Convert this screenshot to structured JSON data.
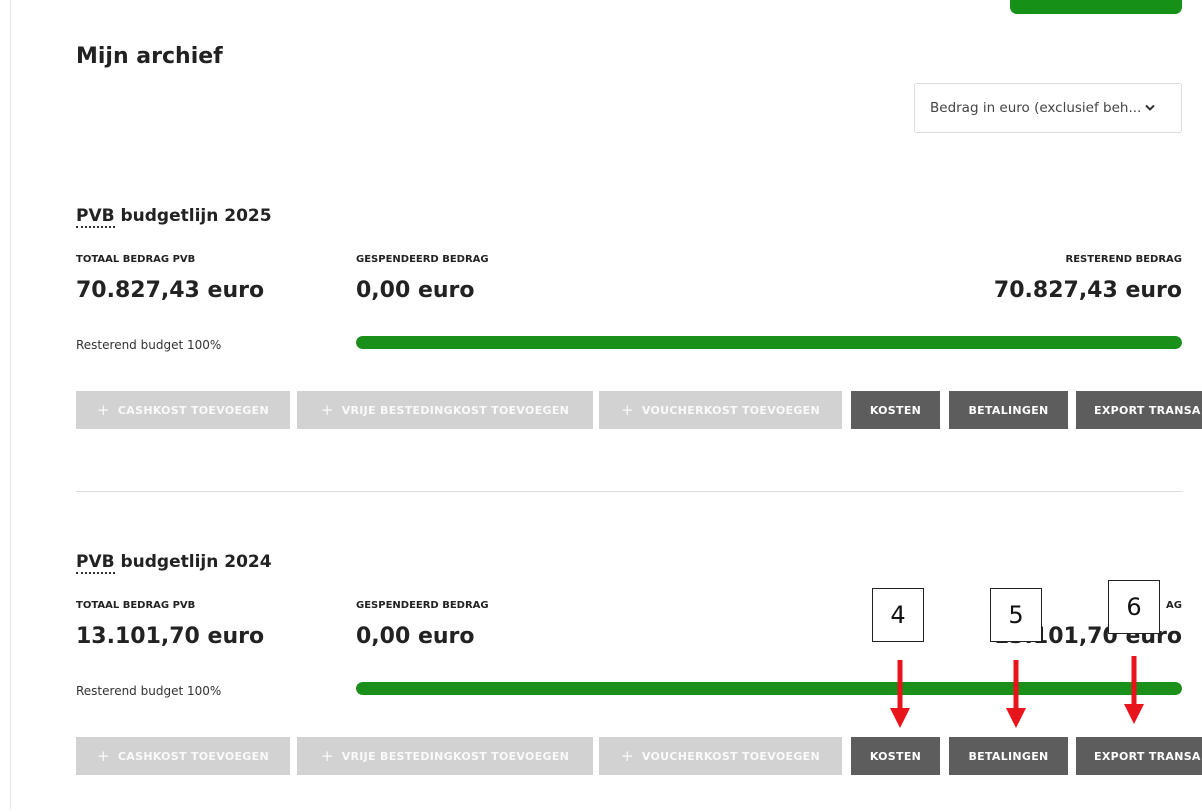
{
  "page": {
    "title": "Mijn archief"
  },
  "currency_select": {
    "value": "Bedrag in euro (exclusief beh..."
  },
  "budgets": [
    {
      "title_abbr": "PVB",
      "title_rest": " budgetlijn 2025",
      "labels": {
        "total": "TOTAAL BEDRAG PVB",
        "spent": "GESPENDEERD BEDRAG",
        "remaining": "RESTEREND BEDRAG"
      },
      "total": "70.827,43 euro",
      "spent": "0,00 euro",
      "remaining": "70.827,43 euro",
      "remaining_text": "Resterend budget 100%",
      "remaining_fraction": 1.0,
      "buttons": {
        "cash": "CASHKOST TOEVOEGEN",
        "free": "VRIJE BESTEDINGKOST TOEVOEGEN",
        "voucher": "VOUCHERKOST TOEVOEGEN",
        "costs": "KOSTEN",
        "payments": "BETALINGEN",
        "export": "EXPORT TRANSA"
      }
    },
    {
      "title_abbr": "PVB",
      "title_rest": " budgetlijn 2024",
      "labels": {
        "total": "TOTAAL BEDRAG PVB",
        "spent": "GESPENDEERD BEDRAG",
        "remaining": "RESTER    AG"
      },
      "total": "13.101,70 euro",
      "spent": "0,00 euro",
      "remaining": "13.101,70 euro",
      "remaining_text": "Resterend budget 100%",
      "remaining_fraction": 1.0,
      "buttons": {
        "cash": "CASHKOST TOEVOEGEN",
        "free": "VRIJE BESTEDINGKOST TOEVOEGEN",
        "voucher": "VOUCHERKOST TOEVOEGEN",
        "costs": "KOSTEN",
        "payments": "BETALINGEN",
        "export": "EXPORT TRANSA"
      }
    }
  ],
  "annotations": [
    {
      "number": "4",
      "color": "#e8141b"
    },
    {
      "number": "5",
      "color": "#e8141b"
    },
    {
      "number": "6",
      "color": "#e8141b"
    }
  ],
  "colors": {
    "accent_green": "#1a8f1a",
    "button_dark": "#5d5d5d",
    "button_disabled": "#d2d2d2",
    "arrow_red": "#e8141b"
  },
  "icons": {
    "plus": "+",
    "chevron": "❯"
  }
}
